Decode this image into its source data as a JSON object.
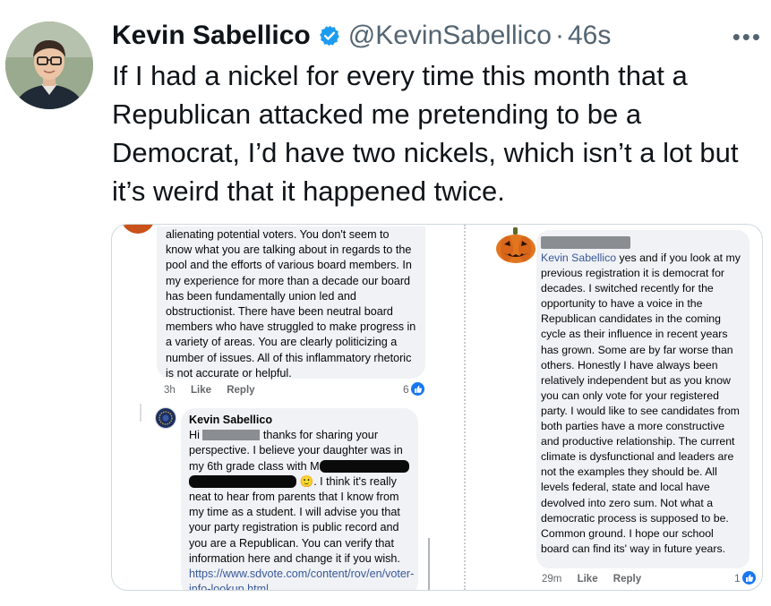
{
  "author": {
    "name": "Kevin Sabellico",
    "handle": "@KevinSabellico",
    "separator": "·",
    "time": "46s",
    "verified": true,
    "avatar_icon": "profile-photo",
    "verified_icon": "verified-badge-icon",
    "verified_color": "#1d9bf0"
  },
  "more_label": "•••",
  "tweet_text": "If I had a nickel for every time this month that a Republican attacked me pretending to be a Democrat, I’d have two nickels, which isn’t a lot but it’s weird that it happened twice.",
  "screenshot_left": {
    "comment1": {
      "text": "alienating potential voters. You don't seem to know what you are talking about in regards to the pool and the efforts of various board members. In my experience for more than a decade our board has been fundamentally union led and obstructionist. There have been neutral board members who have struggled to make progress in a variety of areas. You are clearly politicizing a number of issues. All of this inflammatory rhetoric is not accurate or helpful.",
      "time": "3h",
      "like": "Like",
      "reply": "Reply",
      "reactions": "6"
    },
    "reply": {
      "author": "Kevin Sabellico",
      "greeting": "Hi",
      "part1": "thanks for sharing your perspective. I believe your daughter was in my 6th grade class with M",
      "part2": ". I think it's really neat to hear from parents that I know from my time as a student. I will advise you that your party registration is public record and you are a Republican. You can verify that information here and change it if you wish.",
      "emoji": "🙂",
      "link": "https://www.sdvote.com/content/rov/en/voter-info-lookup.html"
    }
  },
  "screenshot_right": {
    "comment": {
      "mention": "Kevin Sabellico",
      "text": "yes and if you look at my previous registration it is democrat for decades. I switched recently for the opportunity to have a voice in the Republican candidates in the coming cycle as their influence in recent years has grown. Some are by far worse than others. Honestly I have always been relatively independent but as you know you can only vote for your registered party. I would like to see candidates from both parties have a more constructive and productive relationship. The current climate is dysfunctional and leaders are not the examples they should be. All levels federal, state and local have devolved into zero sum. Not what a democratic process is supposed to be. Common ground. I hope our school board can find its' way in future years.",
      "time": "29m",
      "like": "Like",
      "reply": "Reply",
      "reactions": "1"
    },
    "avatar_icon": "pumpkin-avatar"
  }
}
